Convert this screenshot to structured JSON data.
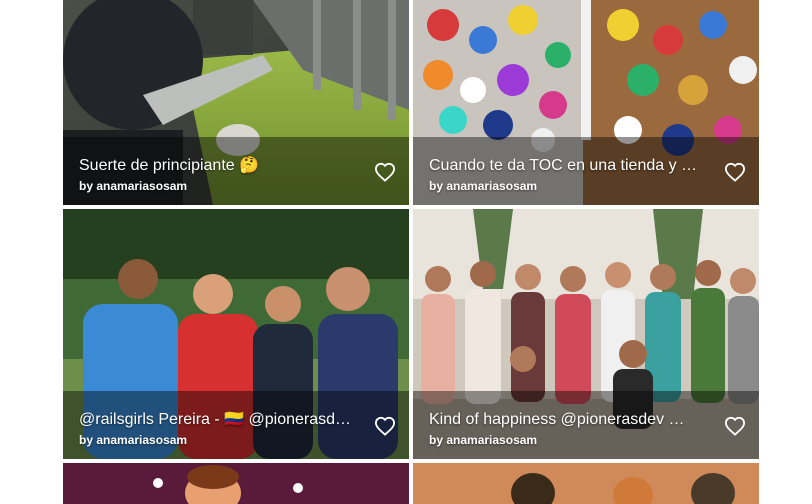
{
  "gallery": {
    "cards": [
      {
        "title": "Suerte de principiante 🤔",
        "by": "by",
        "author": "anamariasosam"
      },
      {
        "title": "Cuando te da TOC en una tienda y org...",
        "by": "by",
        "author": "anamariasosam"
      },
      {
        "title": "@railsgirls Pereira - 🇨🇴 @pionerasdev ...",
        "by": "by",
        "author": "anamariasosam"
      },
      {
        "title": "Kind of happiness @pionerasdev 👩‍💻 👩‍💻 ...",
        "by": "by",
        "author": "anamariasosam"
      }
    ]
  },
  "colors": {
    "overlay": "#000000",
    "text": "#ffffff"
  }
}
